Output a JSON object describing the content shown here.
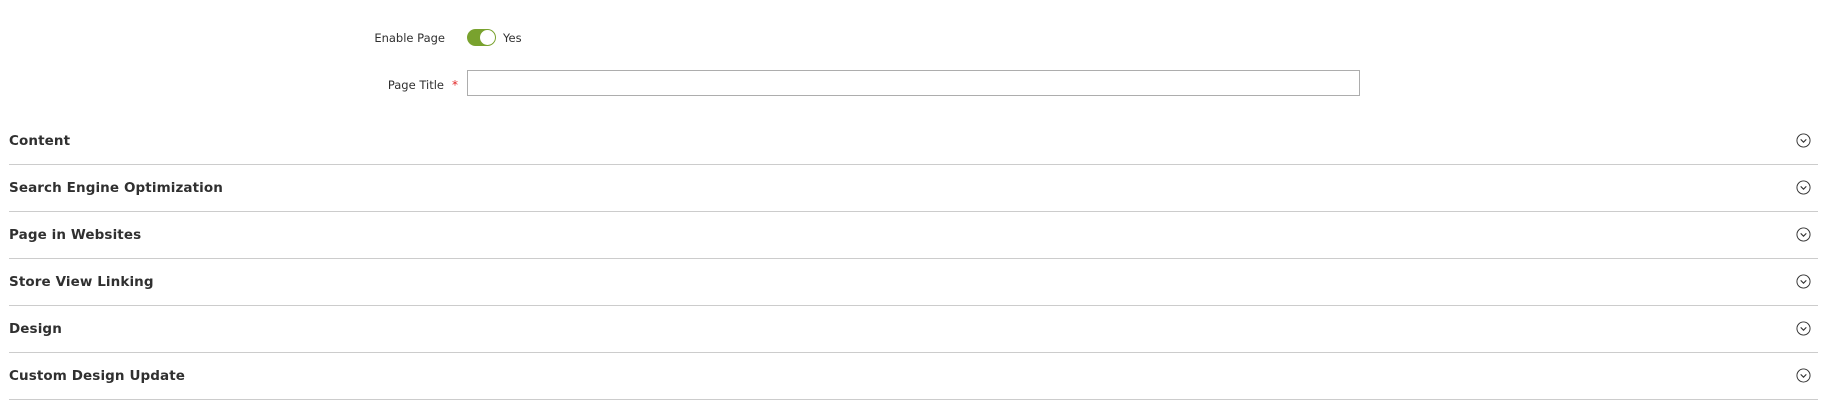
{
  "form": {
    "enable_page": {
      "label": "Enable Page",
      "value_label": "Yes",
      "enabled": true
    },
    "page_title": {
      "label": "Page Title",
      "required_marker": "*",
      "value": "",
      "placeholder": ""
    }
  },
  "sections": [
    {
      "title": "Content",
      "icon": "chevron-down-circle-icon"
    },
    {
      "title": "Search Engine Optimization",
      "icon": "chevron-down-circle-icon"
    },
    {
      "title": "Page in Websites",
      "icon": "chevron-down-circle-icon"
    },
    {
      "title": "Store View Linking",
      "icon": "chevron-down-circle-icon"
    },
    {
      "title": "Design",
      "icon": "chevron-down-circle-icon"
    },
    {
      "title": "Custom Design Update",
      "icon": "chevron-down-circle-icon"
    }
  ],
  "colors": {
    "toggle_on": "#79a22e",
    "required": "#e22626",
    "divider": "#cccccc",
    "text": "#303030"
  }
}
